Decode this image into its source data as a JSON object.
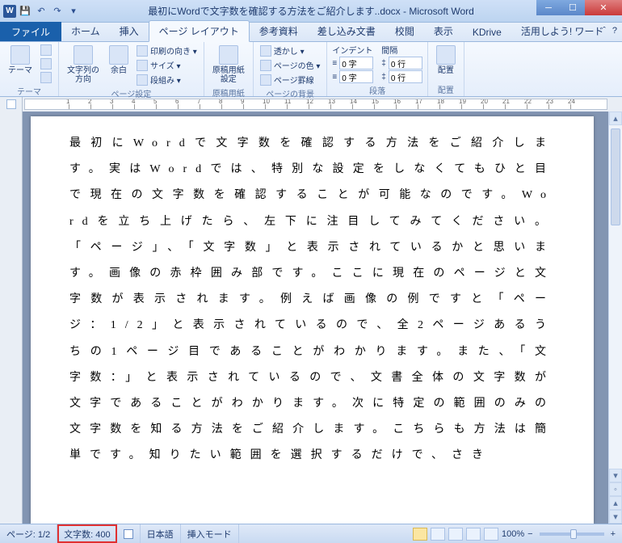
{
  "title": "最初にWordで文字数を確認する方法をご紹介します..docx - Microsoft Word",
  "tabs": {
    "file": "ファイル",
    "items": [
      "ホーム",
      "挿入",
      "ページ レイアウト",
      "参考資料",
      "差し込み文書",
      "校閲",
      "表示",
      "KDrive",
      "活用しよう! ワード"
    ],
    "activeIndex": 2
  },
  "ribbon": {
    "theme": {
      "label": "テーマ",
      "btn": "テーマ"
    },
    "pageSetup": {
      "label": "ページ設定",
      "margin": "余白",
      "orient": "文字列の\n方向",
      "items": [
        "印刷の向き ▾",
        "サイズ ▾",
        "段組み ▾"
      ]
    },
    "genko": {
      "label": "原稿用紙",
      "btn": "原稿用紙\n設定"
    },
    "pageBg": {
      "label": "ページの背景",
      "items": [
        "透かし ▾",
        "ページの色 ▾",
        "ページ罫線"
      ]
    },
    "paragraph": {
      "label": "段落",
      "indent": "インデント",
      "spacing": "間隔",
      "leftVal": "0 字",
      "rightVal": "0 字",
      "beforeVal": "0 行",
      "afterVal": "0 行"
    },
    "arrange": {
      "label": "配置",
      "btn": "配置"
    }
  },
  "document_text": "最初にWordで文字数を確認する方法をご紹介します。実はWordでは、特別な設定をしなくてもひと目で現在の文字数を確認することが可能なのです。Wordを立ち上げたら、左下に注目してみてください。「ページ」、「文字数」と表示されているかと思います。画像の赤枠囲み部です。ここに現在のページと文字数が表示されます。例えば画像の例ですと「ページ：1/2」と表示されているので、全2ページあるうちの1ページ目であることがわかります。また、「文字数：」と表示されているので、文書全体の文字数が文字であることがわかります。次に特定の範囲のみの文字数を知る方法をご紹介します。こちらも方法は簡単です。知りたい範囲を選択するだけで、さき",
  "status": {
    "page": "ページ: 1/2",
    "chars": "文字数: 400",
    "lang": "日本語",
    "mode": "挿入モード",
    "zoom": "100%"
  }
}
